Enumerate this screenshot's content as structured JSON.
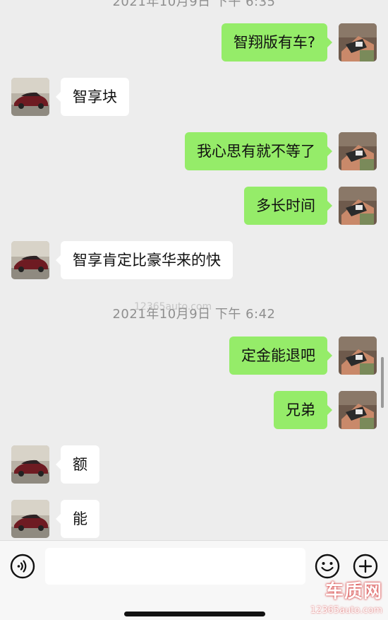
{
  "chat": {
    "timestamps": [
      "2021年10月9日 下午 6:35",
      "2021年10月9日 下午 6:42"
    ],
    "messages": [
      {
        "side": "out",
        "text": "智翔版有车?"
      },
      {
        "side": "in",
        "text": "智享块"
      },
      {
        "side": "out",
        "text": "我心思有就不等了"
      },
      {
        "side": "out",
        "text": "多长时间"
      },
      {
        "side": "in",
        "text": "智享肯定比豪华来的快"
      },
      {
        "side": "out",
        "text": "定金能退吧"
      },
      {
        "side": "out",
        "text": "兄弟"
      },
      {
        "side": "in",
        "text": "额"
      },
      {
        "side": "in",
        "text": "能"
      }
    ]
  },
  "input": {
    "placeholder": ""
  },
  "watermark": {
    "logo": "车质网",
    "url": "12365auto.com",
    "overlay": "12365auto.com"
  },
  "colors": {
    "background": "#ededed",
    "outgoing_bubble": "#95ec69",
    "incoming_bubble": "#ffffff"
  },
  "icons": {
    "voice": "voice-icon",
    "emoji": "emoji-icon",
    "plus": "plus-icon"
  }
}
